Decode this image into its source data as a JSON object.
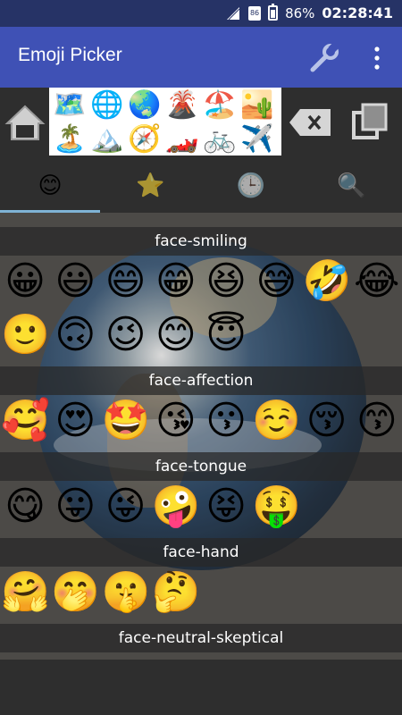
{
  "status": {
    "battery": "86%",
    "time": "02:28:41",
    "sim_badge": "86"
  },
  "appbar": {
    "title": "Emoji Picker"
  },
  "ad": {
    "emojis": [
      "🗺️",
      "🌐",
      "🌏",
      "🌋",
      "🏖️",
      "🏜️",
      "🏝️",
      "🏔️",
      "🧭",
      "🏎️",
      "🚲",
      "✈️"
    ]
  },
  "tabs": [
    {
      "name": "tab-smileys",
      "icon": "😊"
    },
    {
      "name": "tab-favorites",
      "icon": "⭐"
    },
    {
      "name": "tab-recent",
      "icon": "🕒"
    },
    {
      "name": "tab-search",
      "icon": "🔍"
    }
  ],
  "sections": [
    {
      "label": "face-smiling",
      "rows": [
        [
          "😀",
          "😃",
          "😄",
          "😁",
          "😆",
          "😅",
          "🤣",
          "😂"
        ],
        [
          "🙂",
          "🙃",
          "😉",
          "😊",
          "😇"
        ]
      ]
    },
    {
      "label": "face-affection",
      "rows": [
        [
          "🥰",
          "😍",
          "🤩",
          "😘",
          "😗",
          "☺️",
          "😚",
          "😙"
        ]
      ]
    },
    {
      "label": "face-tongue",
      "rows": [
        [
          "😋",
          "😛",
          "😜",
          "🤪",
          "😝",
          "🤑"
        ]
      ]
    },
    {
      "label": "face-hand",
      "rows": [
        [
          "🤗",
          "🤭",
          "🤫",
          "🤔"
        ]
      ]
    },
    {
      "label": "face-neutral-skeptical",
      "rows": []
    }
  ],
  "colors": {
    "status": "#263366",
    "appbar": "#3f51b5",
    "background": "#2e2e2e",
    "indicator": "#7fb3d5"
  }
}
